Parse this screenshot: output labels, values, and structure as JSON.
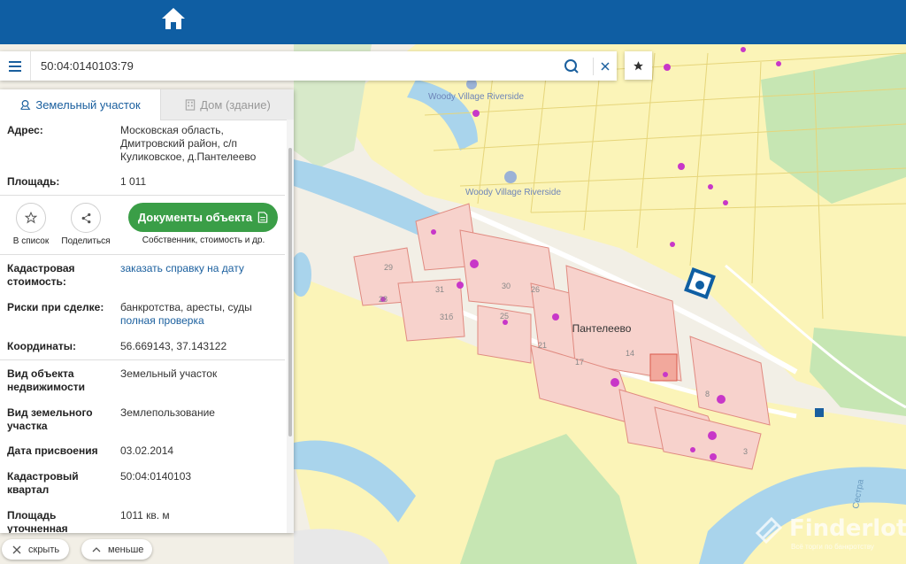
{
  "search": {
    "value": "50:04:0140103:79"
  },
  "tabs": [
    {
      "label": "Земельный участок",
      "active": true
    },
    {
      "label": "Дом (здание)",
      "active": false
    }
  ],
  "details": {
    "address_label": "Адрес:",
    "address_value": "Московская область, Дмитровский район, с/п Куликовское, д.Пантелеево",
    "area_label": "Площадь:",
    "area_value": "1 011",
    "cad_cost_label": "Кадастровая стоимость:",
    "cad_cost_link": "заказать справку на дату",
    "risks_label": "Риски при сделке:",
    "risks_value": "банкротства, аресты, суды",
    "risks_link": "полная проверка",
    "coords_label": "Координаты:",
    "coords_value": "56.669143, 37.143122",
    "object_type_label": "Вид объекта недвижимости",
    "object_type_value": "Земельный участок",
    "land_type_label": "Вид земельного участка",
    "land_type_value": "Землепользование",
    "date_label": "Дата присвоения",
    "date_value": "03.02.2014",
    "quarter_label": "Кадастровый квартал",
    "quarter_value": "50:04:0140103",
    "precise_area_label": "Площадь уточненная",
    "precise_area_value": "1011 кв. м"
  },
  "actions": {
    "favorite_label": "В список",
    "share_label": "Поделиться",
    "docs_label": "Документы объекта",
    "docs_sub": "Собственник, стоимость и др."
  },
  "bottom": {
    "hide_label": "скрыть",
    "less_label": "меньше"
  },
  "map": {
    "place_name": "Пантелеево",
    "poi_1": "Woody Village Riverside",
    "poi_2": "Woody Village Riverside",
    "river_label": "Сестра",
    "parcel_numbers": [
      "29",
      "31",
      "31б",
      "28",
      "30",
      "26",
      "25",
      "21",
      "17",
      "14",
      "8",
      "3"
    ]
  },
  "watermark": {
    "name": "Finderlot",
    "sub": "Всё торги по банкротству"
  },
  "colors": {
    "header": "#0f5ea3",
    "accent": "#1a5f9e",
    "docs_button": "#3a9e47",
    "water": "#a9d4ec",
    "green": "#c6e6b3",
    "yellow_zone": "#fbf4b8",
    "parcel": "#f7d2cc",
    "marker": "#c837c8"
  }
}
